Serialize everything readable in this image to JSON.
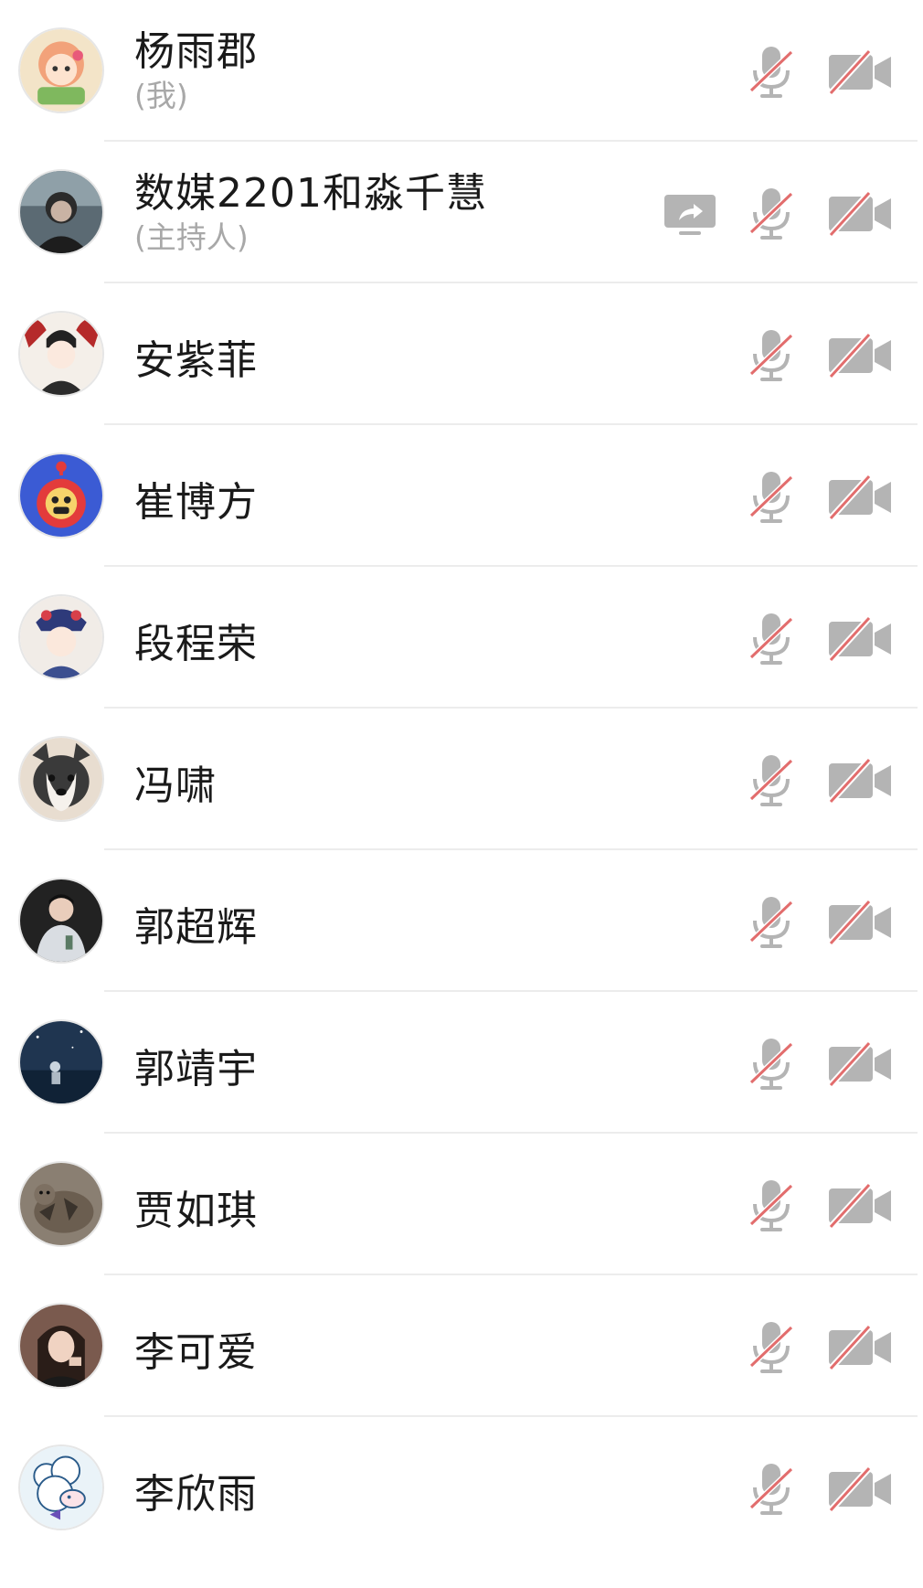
{
  "participants": [
    {
      "name": "杨雨郡",
      "role": "(我)",
      "avatar": "cartoon-girl-avatar",
      "avatar_bg": "#f3e4c8",
      "sharing": false
    },
    {
      "name": "数媒2201和淼千慧",
      "role": "(主持人)",
      "avatar": "dark-photo-avatar",
      "avatar_bg": "#5b6a73",
      "sharing": true
    },
    {
      "name": "安紫菲",
      "role": "",
      "avatar": "anime-boy-avatar",
      "avatar_bg": "#f4efe9",
      "sharing": false
    },
    {
      "name": "崔博方",
      "role": "",
      "avatar": "teletubby-avatar",
      "avatar_bg": "#3b5bd4",
      "sharing": false
    },
    {
      "name": "段程荣",
      "role": "",
      "avatar": "illustrated-girl-avatar",
      "avatar_bg": "#f1ece7",
      "sharing": false
    },
    {
      "name": "冯啸",
      "role": "",
      "avatar": "husky-dog-avatar",
      "avatar_bg": "#e8ddd0",
      "sharing": false
    },
    {
      "name": "郭超辉",
      "role": "",
      "avatar": "man-photo-avatar",
      "avatar_bg": "#222222",
      "sharing": false
    },
    {
      "name": "郭靖宇",
      "role": "",
      "avatar": "night-scene-avatar",
      "avatar_bg": "#1f3550",
      "sharing": false
    },
    {
      "name": "贾如琪",
      "role": "",
      "avatar": "cat-photo-avatar",
      "avatar_bg": "#8a7f72",
      "sharing": false
    },
    {
      "name": "李可爱",
      "role": "",
      "avatar": "girl-photo-avatar",
      "avatar_bg": "#7a5a4e",
      "sharing": false
    },
    {
      "name": "李欣雨",
      "role": "",
      "avatar": "sheep-cartoon-avatar",
      "avatar_bg": "#eaf3f8",
      "sharing": false
    }
  ],
  "colors": {
    "icon_gray": "#b4b4b4",
    "slash_red": "#e26d6d",
    "share_bg": "#b4b4b4"
  }
}
